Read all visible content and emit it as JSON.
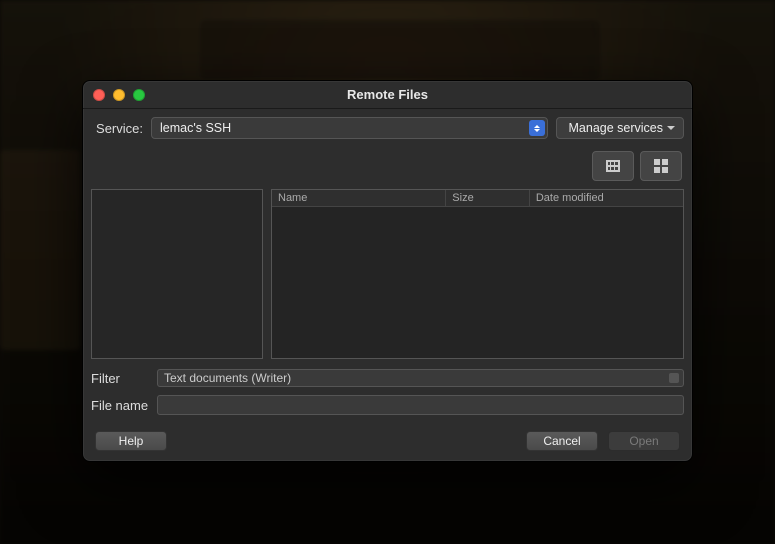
{
  "window": {
    "title": "Remote Files"
  },
  "service": {
    "label": "Service:",
    "selected": "lemac's SSH",
    "manage_label": "Manage services"
  },
  "view": {
    "list_icon": "list-view-icon",
    "grid_icon": "grid-view-icon"
  },
  "columns": {
    "name": "Name",
    "size": "Size",
    "date": "Date modified"
  },
  "filter": {
    "label": "Filter",
    "selected": "Text documents (Writer)"
  },
  "filename": {
    "label": "File name",
    "value": ""
  },
  "buttons": {
    "help": "Help",
    "cancel": "Cancel",
    "open": "Open"
  },
  "colors": {
    "accent": "#3a6fd8"
  }
}
